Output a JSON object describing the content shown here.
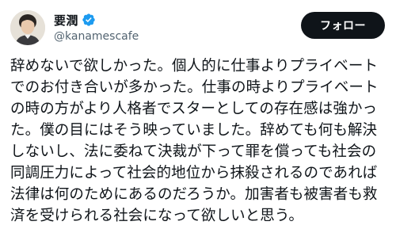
{
  "author": {
    "display_name": "要潤",
    "handle": "@kanamescafe",
    "verified": true
  },
  "follow_button": {
    "label": "フォロー"
  },
  "tweet": {
    "text": "辞めないで欲しかった。個人的に仕事よりプライベート\nでのお付き合いが多かった。仕事の時よりプライベート\nの時の方がより人格者でスターとしての存在感は強かっ\nた。僕の目にはそう映っていました。辞めても何も解決\nしないし、法に委ねて決裁が下って罪を償っても社会の\n同調圧力によって社会的地位から抹殺されるのであれば\n法律は何のためにあるのだろうか。加害者も被害者も救\n済を受けられる社会になって欲しいと思う。"
  },
  "colors": {
    "text": "#0f1419",
    "secondary": "#536471",
    "verified": "#1d9bf0",
    "button_bg": "#0f1419",
    "button_text": "#ffffff"
  },
  "icons": {
    "verified": "verified-badge-icon"
  }
}
